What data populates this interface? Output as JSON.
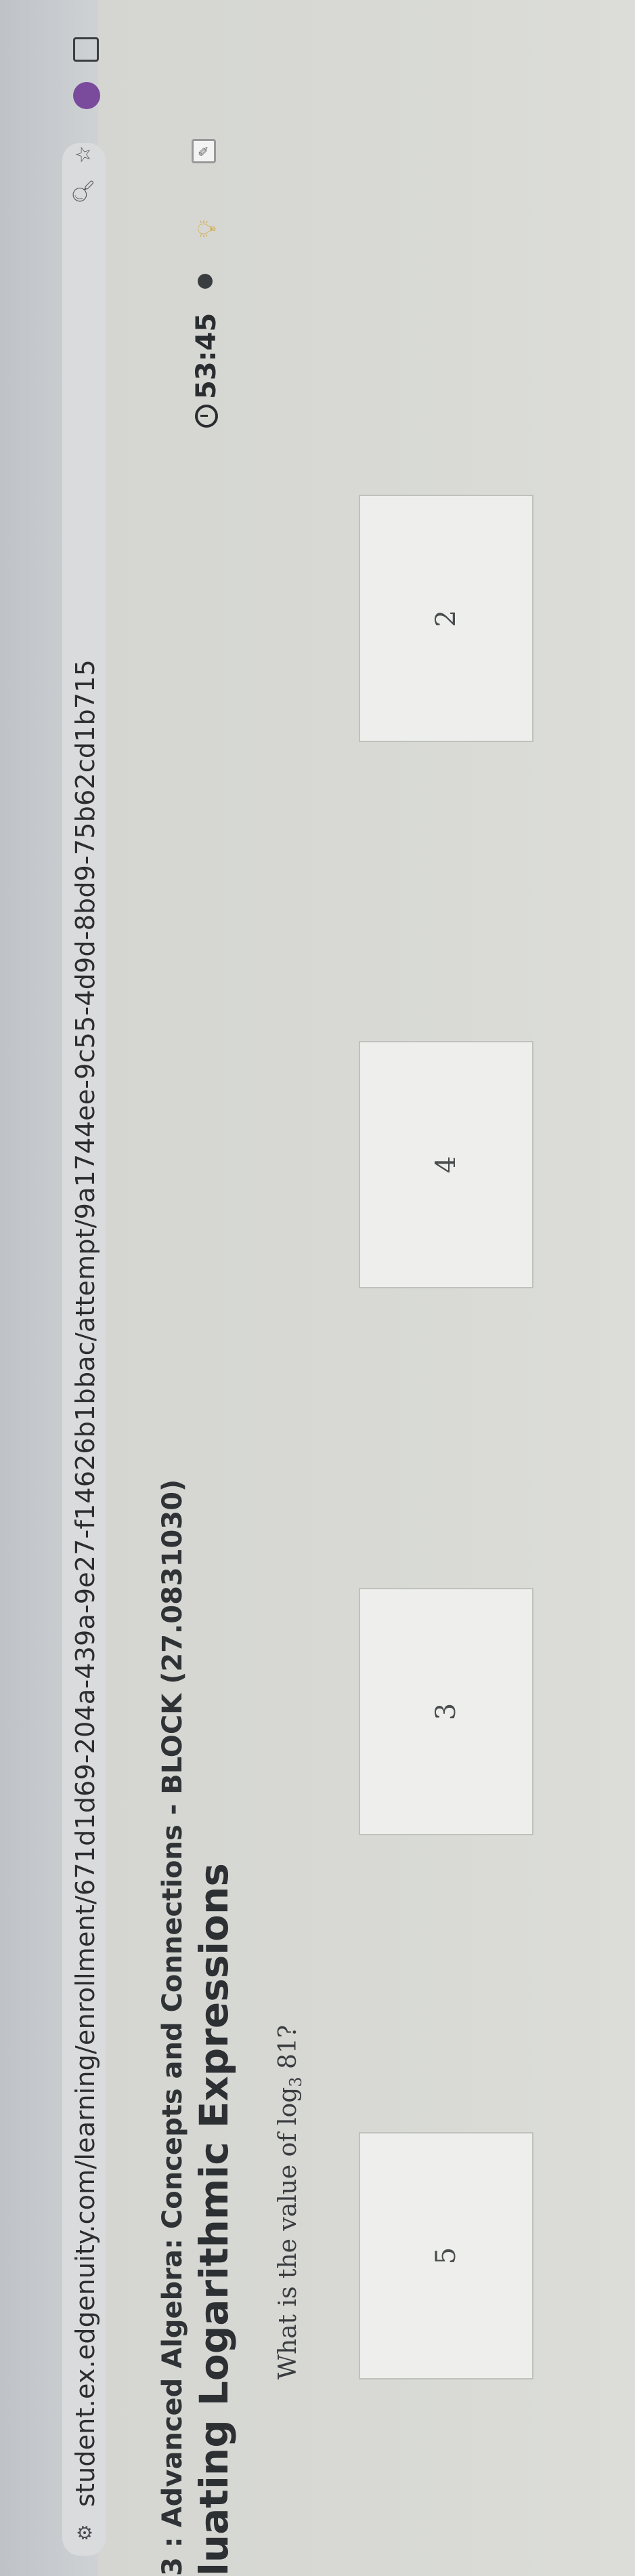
{
  "browser": {
    "url": "student.ex.edgenuity.com/learning/enrollment/671d1d69-204a-439a-9e27-f14626b1bbac/attempt/9a1744ee-9c55-4d9d-8bd9-75b62cd1b715"
  },
  "course": {
    "title": "3 : Advanced Algebra: Concepts and Connections - BLOCK (27.0831030)",
    "lesson": "luating Logarithmic Expressions",
    "timer": "53:45"
  },
  "question": {
    "prefix": "What is the value of log",
    "base": "3",
    "suffix": " 81?"
  },
  "options": [
    "5",
    "3",
    "4",
    "2"
  ],
  "icons": {
    "site": "site-info-icon",
    "zoom": "zoom-icon",
    "star": "bookmark-star-icon",
    "extension": "extension-icon",
    "window": "window-icon",
    "clock": "clock-icon",
    "dot": "status-dot-icon",
    "bulb": "lightbulb-icon",
    "tool": "tool-icon"
  }
}
